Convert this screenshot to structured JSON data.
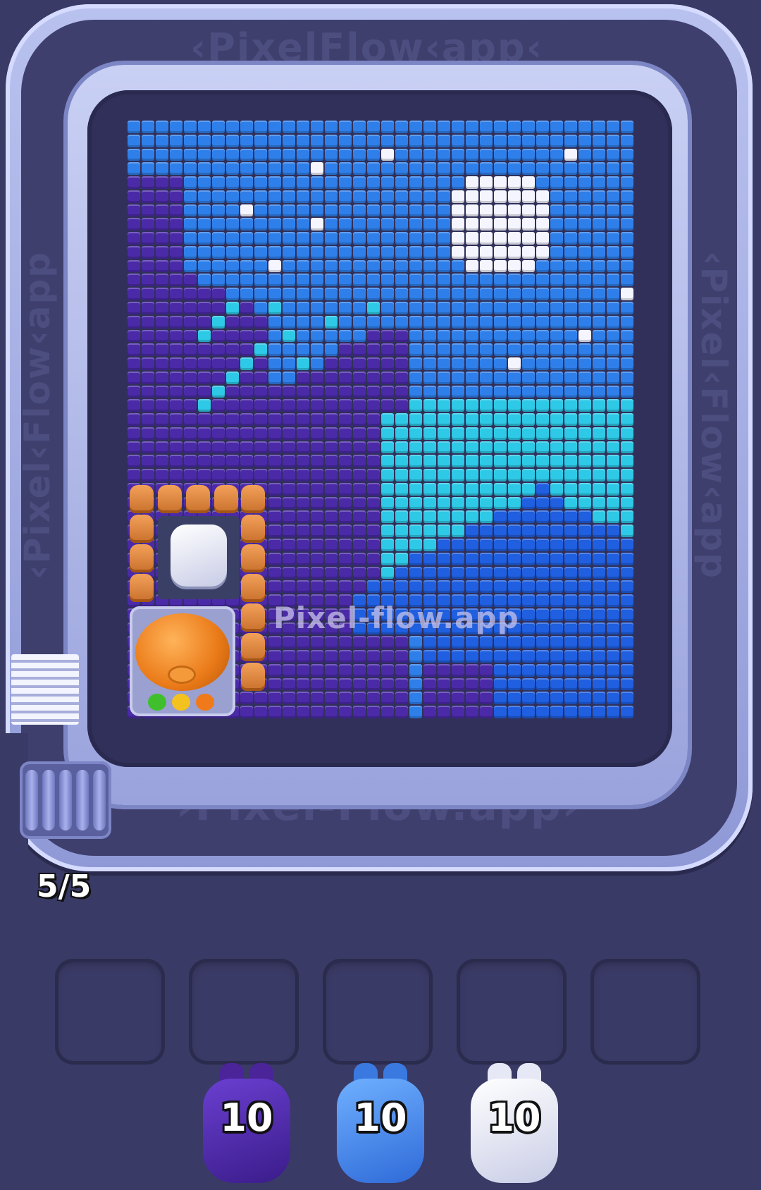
{
  "track": {
    "top_text": "‹PixelFlow‹app‹",
    "bottom_text": "›Pixel-Flow.app›",
    "side_text": "‹Pixel‹Flow‹app"
  },
  "watermark": "Pixel-flow.app",
  "queue": {
    "count_label": "5/5"
  },
  "slots": [
    {
      "id": 1,
      "state": "empty"
    },
    {
      "id": 2,
      "state": "empty"
    },
    {
      "id": 3,
      "state": "empty"
    },
    {
      "id": 4,
      "state": "empty"
    },
    {
      "id": 5,
      "state": "empty"
    }
  ],
  "shooters": [
    {
      "color_name": "purple",
      "color": "#5a2fb8",
      "count": "10"
    },
    {
      "color_name": "blue",
      "color": "#4a8ff0",
      "count": "10"
    },
    {
      "color_name": "white",
      "color": "#f2f3fb",
      "count": "10"
    }
  ],
  "palette": {
    "sky": "#2f7fea",
    "cyan": "#2ec9e6",
    "deep_blue": "#1f5fe0",
    "purple": "#4b2aa8",
    "white": "#f4f5ff"
  },
  "picture": {
    "cols": 36,
    "rows": 43,
    "subject": "night landscape with full moon and stars"
  }
}
